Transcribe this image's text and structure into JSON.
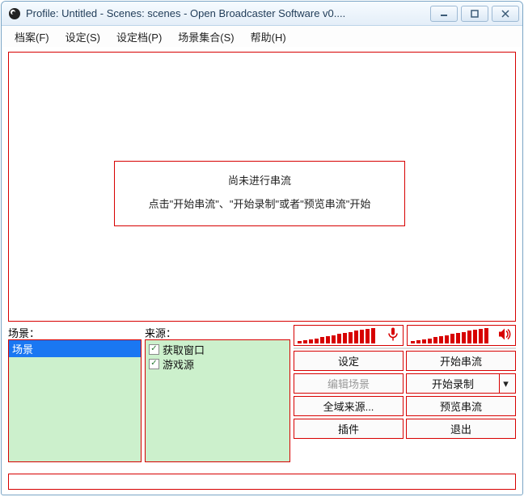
{
  "window_title": "Profile: Untitled - Scenes: scenes - Open Broadcaster Software v0....",
  "menu": {
    "file": "档案(F)",
    "settings": "设定(S)",
    "profile": "设定档(P)",
    "sceneset": "场景集合(S)",
    "help": "帮助(H)"
  },
  "preview": {
    "line1": "尚未进行串流",
    "line2": "点击\"开始串流\"、\"开始录制\"或者\"预览串流\"开始"
  },
  "scenes": {
    "label": "场景：",
    "items": [
      {
        "name": "场景"
      }
    ]
  },
  "sources": {
    "label": "来源：",
    "items": [
      {
        "name": "获取窗口",
        "checked": true
      },
      {
        "name": "游戏源",
        "checked": true
      }
    ]
  },
  "buttons": {
    "settings": "设定",
    "start_stream": "开始串流",
    "edit_scene": "编辑场景",
    "start_record": "开始录制",
    "global_sources": "全域来源...",
    "preview_stream": "预览串流",
    "plugins": "插件",
    "exit": "退出"
  },
  "meters": {
    "mic_levels": [
      2,
      3,
      4,
      5,
      6,
      7,
      8,
      9,
      10,
      11,
      12,
      13,
      14,
      15
    ],
    "speaker_levels": [
      2,
      3,
      4,
      5,
      6,
      7,
      8,
      9,
      10,
      11,
      12,
      13,
      14,
      15
    ]
  },
  "colors": {
    "accent": "#d70000"
  }
}
